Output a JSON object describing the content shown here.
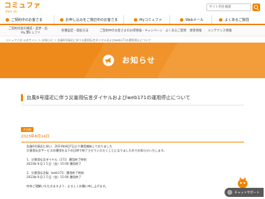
{
  "header": {
    "logo_main": "コミュファ",
    "logo_sub": "from ctc",
    "search_placeholder": "サイト内を検索"
  },
  "main_nav": [
    {
      "label": "ご契約中のお客さま",
      "icon": "user-icon"
    },
    {
      "label": "お申し込みをご検討中のお客さま",
      "icon": "document-icon"
    },
    {
      "label": "Myコミュファ",
      "icon": "person-icon"
    },
    {
      "label": "Webメール",
      "icon": "mail-icon"
    },
    {
      "label": "よくあるご質問",
      "icon": "question-icon"
    }
  ],
  "sub_nav": [
    "ご契約内容の確認・変更・追加",
    "Myコミュファ",
    "各種設定・取扱方法",
    "ご契約中のお客さまのお得情報・キャンペーン",
    "よくあるご質問",
    "障害情報",
    "メンテナンス情報"
  ],
  "breadcrumb": "コミュファ光 公式サイト ＞ お知らせ ＞ 台風6号接近に伴う災害用伝言ダイヤルおよびweb171の運用停止について",
  "banner": {
    "title": "お知らせ",
    "icon": "megaphone-icon"
  },
  "article": {
    "title": "台風6号接近に伴う災害用伝言ダイヤルおよびweb171の運用停止について",
    "badge": "その他",
    "date": "2023年8月14日",
    "lines": [
      "台風6号接近に伴い、2023年8月7日より運用開始しておりました",
      "災害用伝言サービスの運用を以下の日時で終了させていただくことになりましたのでお知らせいたします。",
      "",
      "1．災害用伝言ダイヤル（171）運用終了時刻",
      "2023年９月１５日（金）15:00 運用終了",
      "",
      "2．災害用伝言板（web171）運用終了時刻",
      "2023年９月１５日（金）15:00 運用終了",
      "",
      "何卒ご理解いただきますよう、よろしくお願い申し上げます。"
    ]
  },
  "chat": {
    "label": "チャットサポート",
    "icon": "mascot-icon"
  },
  "colors": {
    "brand_orange": "#f08300",
    "banner_orange": "#f0932b"
  }
}
